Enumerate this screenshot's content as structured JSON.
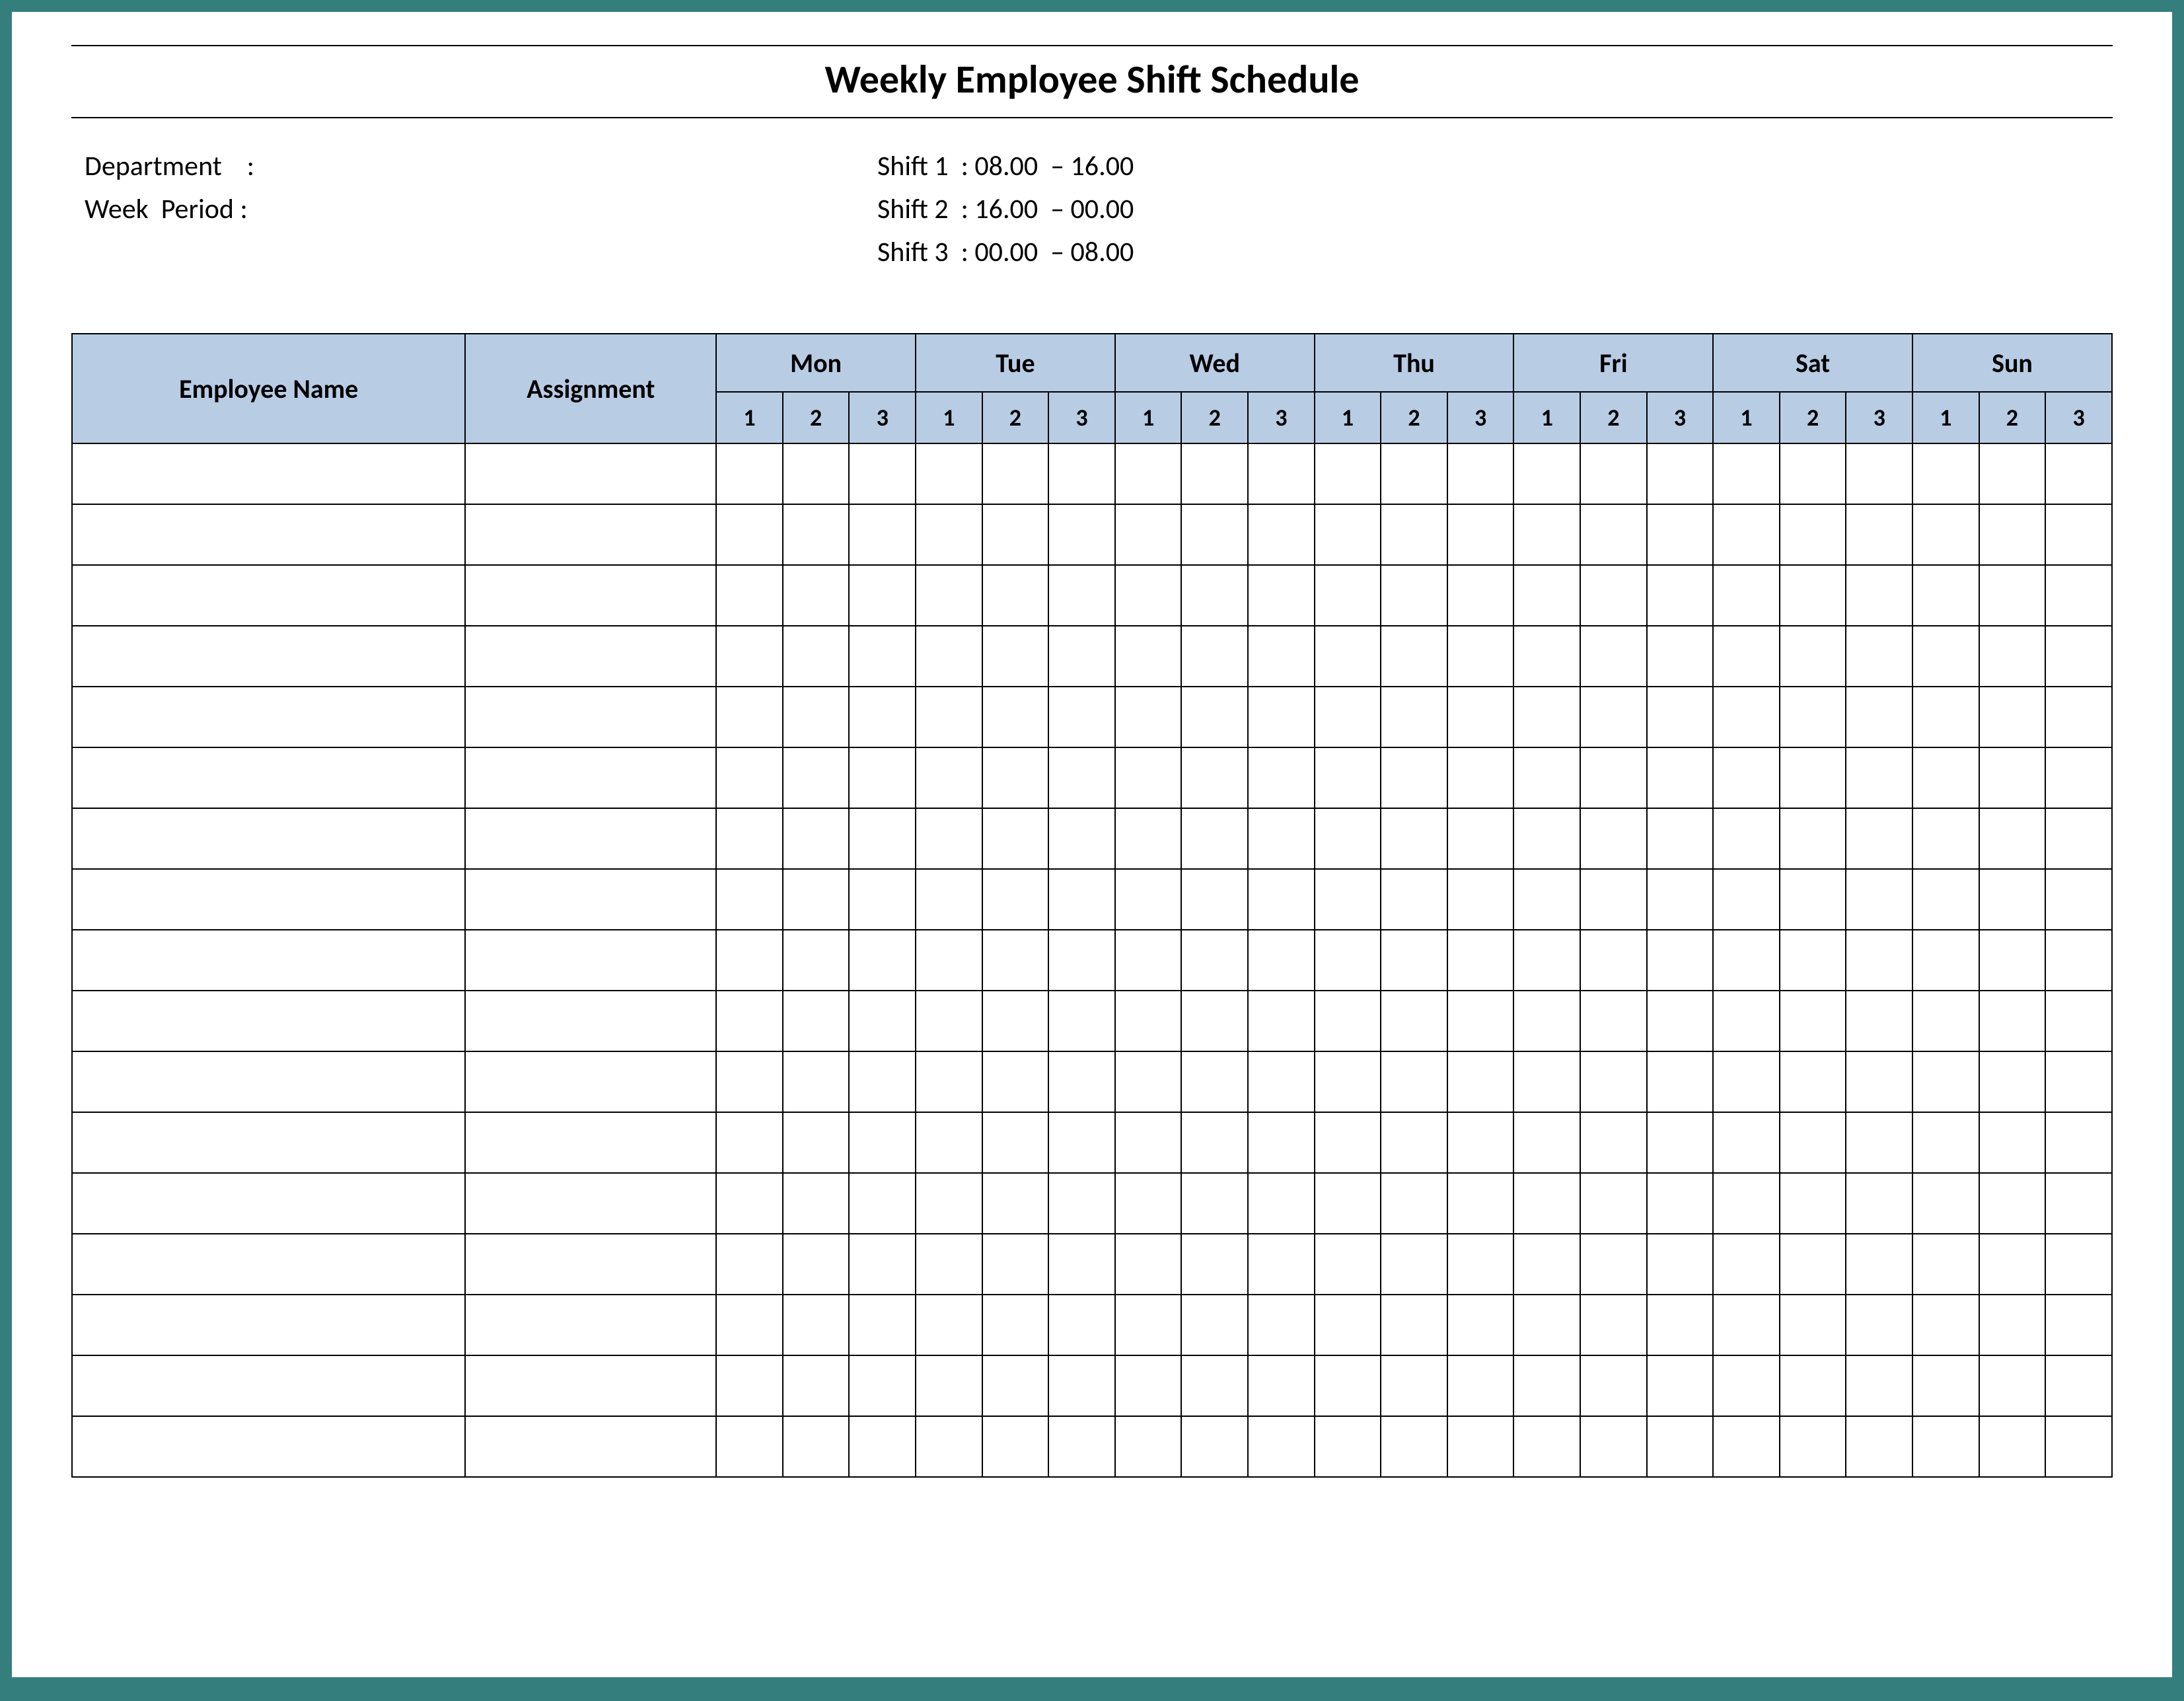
{
  "title": "Weekly Employee Shift Schedule",
  "meta": {
    "department_label": "Department    :",
    "week_period_label": "Week  Period :",
    "shift1": "Shift 1  : 08.00  – 16.00",
    "shift2": "Shift 2  : 16.00  – 00.00",
    "shift3": "Shift 3  : 00.00  – 08.00"
  },
  "headers": {
    "employee_name": "Employee Name",
    "assignment": "Assignment",
    "days": [
      "Mon",
      "Tue",
      "Wed",
      "Thu",
      "Fri",
      "Sat",
      "Sun"
    ],
    "shift_numbers": [
      "1",
      "2",
      "3"
    ]
  },
  "num_rows": 17
}
